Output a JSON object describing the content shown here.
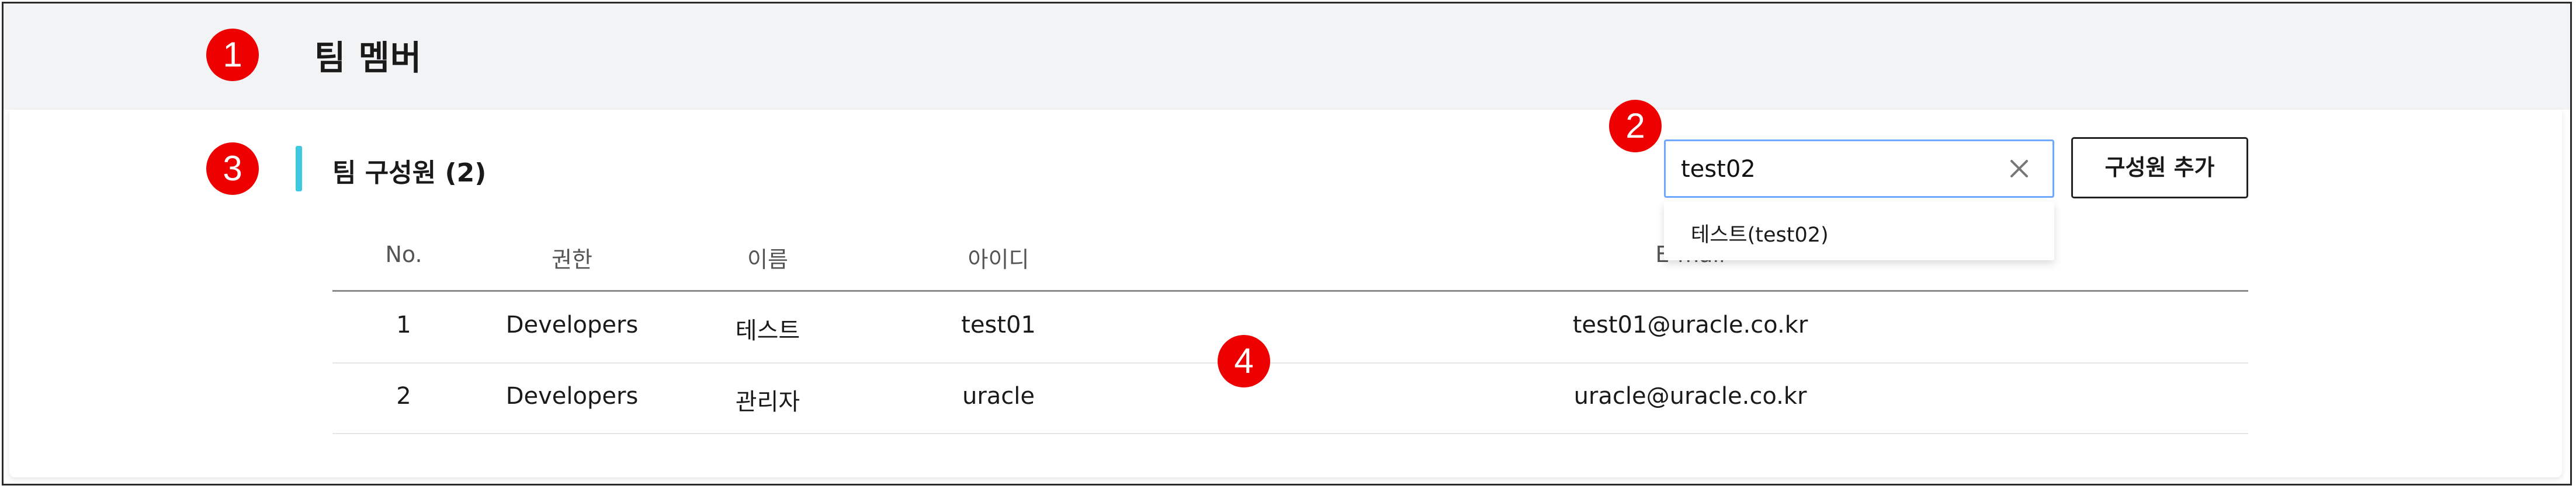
{
  "page": {
    "title": "팀 멤버"
  },
  "section": {
    "title": "팀 구성원 (2)"
  },
  "search": {
    "value": "test02",
    "placeholder": ""
  },
  "add_button": {
    "label": "구성원 추가"
  },
  "autocomplete": {
    "items": [
      {
        "label": "테스트(test02)"
      }
    ]
  },
  "table": {
    "columns": [
      "No.",
      "권한",
      "이름",
      "아이디",
      "E-mail"
    ],
    "rows": [
      {
        "no": "1",
        "role": "Developers",
        "name": "테스트",
        "id": "test01",
        "email": "test01@uracle.co.kr"
      },
      {
        "no": "2",
        "role": "Developers",
        "name": "관리자",
        "id": "uracle",
        "email": "uracle@uracle.co.kr"
      }
    ]
  },
  "markers": [
    "1",
    "2",
    "3",
    "4"
  ],
  "colors": {
    "accent_bar": "#3ec9e0",
    "search_border": "#6fa8ff",
    "marker": "#ee0000",
    "header_bg": "#f2f3f5"
  }
}
